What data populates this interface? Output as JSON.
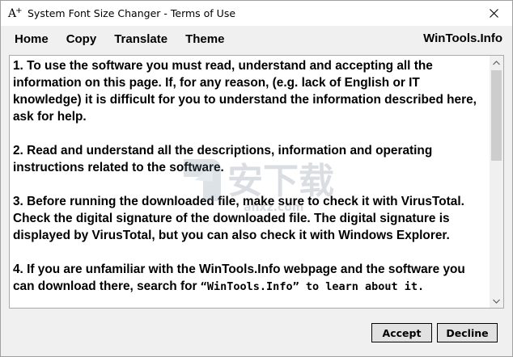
{
  "window": {
    "title": "System Font Size Changer - Terms of Use"
  },
  "menu": {
    "items": [
      "Home",
      "Copy",
      "Translate",
      "Theme"
    ],
    "site": "WinTools.Info"
  },
  "terms": {
    "p1": "1. To use the software you must read, understand and accepting all the information on this page. If, for any reason, (e.g. lack of English or IT knowledge) it is difficult for you to understand the information described here, ask for help.",
    "p2": "2. Read and understand all the descriptions, information and operating instructions related to the software.",
    "p3": "3. Before running the downloaded file, make sure to check it with VirusTotal. Check the digital signature of the downloaded file. The digital signature is displayed by VirusTotal, but you can also check it with Windows Explorer.",
    "p4_a": "4. If you are unfamiliar with the WinTools.Info webpage and the software you can download there, search for ",
    "p4_b": "“WinTools.Info” to learn about it."
  },
  "buttons": {
    "accept": "Accept",
    "decline": "Decline"
  },
  "watermark": {
    "text": "安下载",
    "sub": "anxz.com"
  }
}
